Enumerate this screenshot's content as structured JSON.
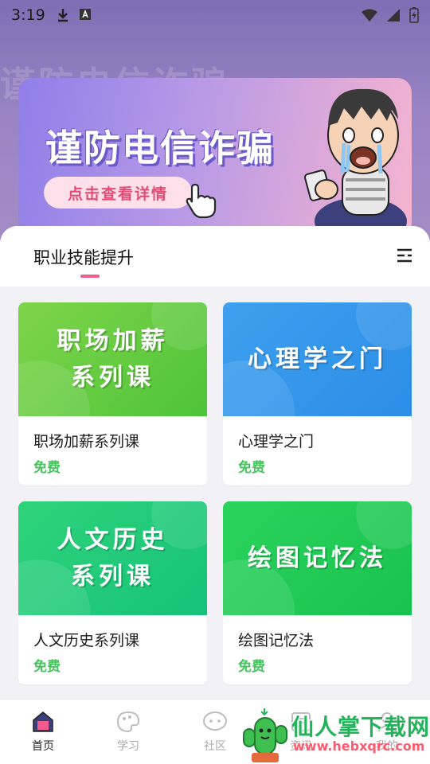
{
  "status_bar": {
    "time": "3:19"
  },
  "hero": {
    "ghost_text": "谨防电信诈骗"
  },
  "banner": {
    "title": "谨防电信诈骗",
    "button": "点击查看详情"
  },
  "tabs": {
    "active": "职业技能提升",
    "accent_color": "#ef5c8d"
  },
  "courses": [
    {
      "thumb_lines": [
        "职场加薪",
        "系列课"
      ],
      "title": "职场加薪系列课",
      "price": "免费",
      "theme": "green"
    },
    {
      "thumb_lines": [
        "心理学之门"
      ],
      "title": "心理学之门",
      "price": "免费",
      "theme": "blue"
    },
    {
      "thumb_lines": [
        "人文历史",
        "系列课"
      ],
      "title": "人文历史系列课",
      "price": "免费",
      "theme": "teal"
    },
    {
      "thumb_lines": [
        "绘图记忆法"
      ],
      "title": "绘图记忆法",
      "price": "免费",
      "theme": "lime"
    }
  ],
  "bottom_nav": [
    {
      "label": "首页",
      "icon": "home-icon",
      "active": true
    },
    {
      "label": "学习",
      "icon": "palette-icon"
    },
    {
      "label": "社区",
      "icon": "chat-bubble-icon"
    },
    {
      "label": "资讯",
      "icon": "news-icon"
    },
    {
      "label": "我的",
      "icon": "profile-icon"
    }
  ],
  "watermark": {
    "name": "仙人掌下载网",
    "url": "www.hebxqrc.com"
  }
}
